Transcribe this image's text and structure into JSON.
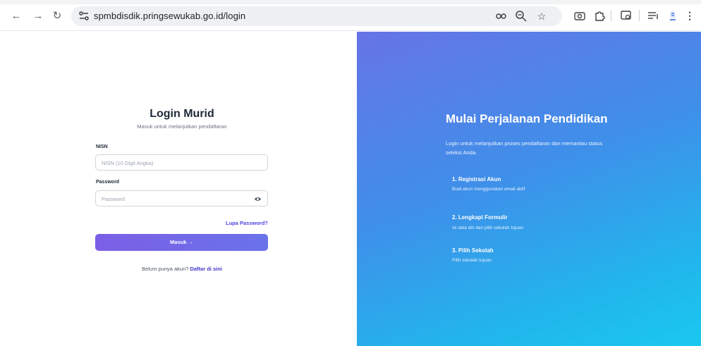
{
  "browser": {
    "url": "spmbdisdik.pringsewukab.go.id/login",
    "icons": [
      "back-arrow-icon",
      "forward-arrow-icon",
      "reload-icon",
      "site-settings-icon",
      "password-key-icon",
      "zoom-icon",
      "bookmark-star-icon",
      "camera-icon",
      "extensions-icon",
      "tab-search-icon",
      "reading-list-icon",
      "profile-icon",
      "menu-kebab-icon"
    ]
  },
  "login": {
    "title": "Login Murid",
    "subtitle": "Masuk untuk melanjutkan pendaftaran",
    "nisn_label": "NISN",
    "nisn_placeholder": "NISN (10 Digit Angka)",
    "password_label": "Password",
    "password_placeholder": "Password",
    "forgot_label": "Lupa Password?",
    "submit_label": "Masuk →",
    "signup_prompt": "Belum punya akun?",
    "signup_link": "Daftar di sini"
  },
  "hero": {
    "title": "Mulai Perjalanan Pendidikan",
    "text": "Login untuk melanjutkan proses pendaftaran dan memantau status seleksi Anda.",
    "steps": [
      {
        "title": "1. Registrasi Akun",
        "desc": "Buat akun menggunakan email aktif"
      },
      {
        "title": "2. Lengkapi Formulir",
        "desc": "Isi data diri dan pilih sekolah tujuan"
      },
      {
        "title": "3. Pilih Sekolah",
        "desc": "Pilih sekolah tujuan"
      }
    ]
  },
  "colors": {
    "accent": "#4f46e5",
    "button_start": "#7b5fe6",
    "button_end": "#6a72ea",
    "panel_start": "#6774e6",
    "panel_end": "#1ac8ef"
  }
}
